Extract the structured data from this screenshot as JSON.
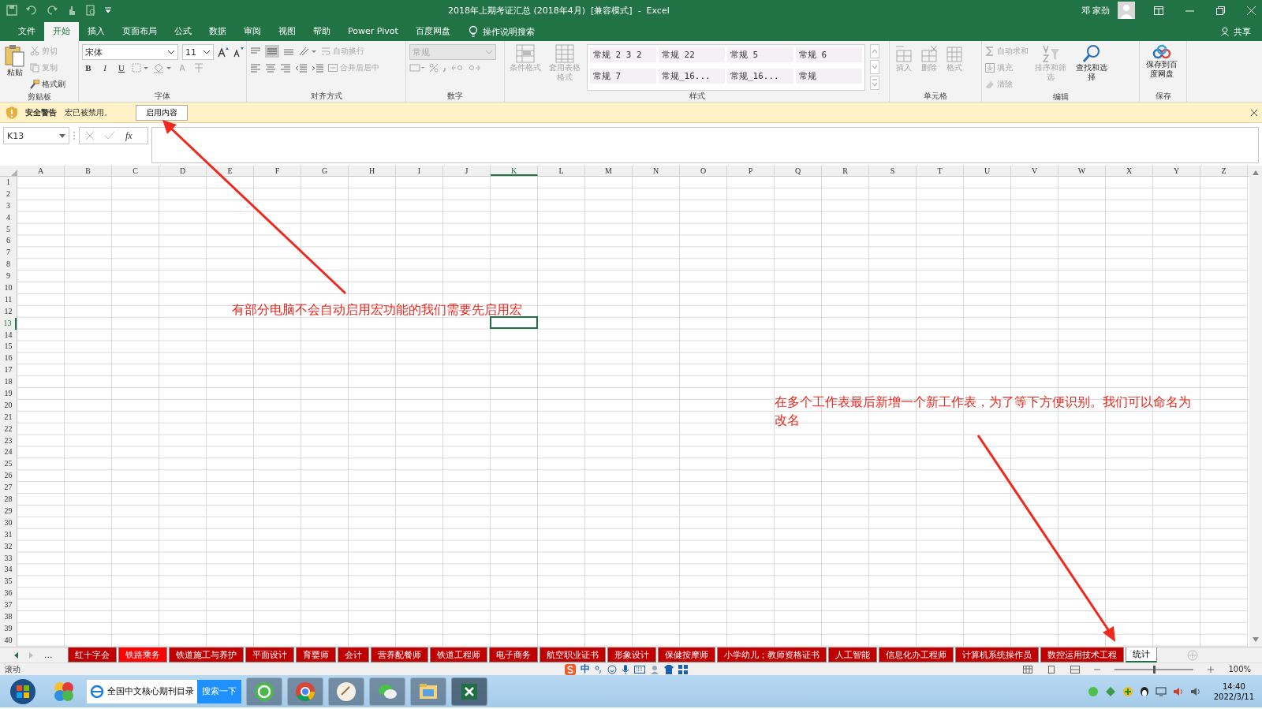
{
  "window": {
    "title": "2018年上期考证汇总 (2018年4月)  [兼容模式]  -  Excel",
    "user": "邓 家劲"
  },
  "ribbon_tabs": [
    {
      "label": "文件",
      "selected": false
    },
    {
      "label": "开始",
      "selected": true
    },
    {
      "label": "插入",
      "selected": false
    },
    {
      "label": "页面布局",
      "selected": false
    },
    {
      "label": "公式",
      "selected": false
    },
    {
      "label": "数据",
      "selected": false
    },
    {
      "label": "审阅",
      "selected": false
    },
    {
      "label": "视图",
      "selected": false
    },
    {
      "label": "帮助",
      "selected": false
    },
    {
      "label": "Power Pivot",
      "selected": false
    },
    {
      "label": "百度网盘",
      "selected": false
    }
  ],
  "tell_me": "操作说明搜索",
  "share": "共享",
  "ribbon": {
    "clipboard": {
      "label": "剪贴板",
      "paste": {
        "text": "粘贴",
        "disabled": false
      },
      "cut": {
        "text": "剪切",
        "disabled": true
      },
      "copy": {
        "text": "复制",
        "disabled": true
      },
      "painter": {
        "text": "格式刷",
        "disabled": false
      }
    },
    "font": {
      "label": "字体",
      "font_name": "宋体",
      "font_size": "11",
      "bold": "B",
      "italic": "I",
      "underline": "U",
      "color_letter": "A"
    },
    "alignment": {
      "label": "对齐方式",
      "wrap": {
        "text": "自动换行",
        "disabled": true
      },
      "merge": {
        "text": "合并后居中",
        "disabled": true
      }
    },
    "number": {
      "label": "数字",
      "format": {
        "text": "常规",
        "disabled": true
      }
    },
    "styles": {
      "label": "样式",
      "conditional": {
        "text": "条件格式",
        "disabled": true
      },
      "table_format": {
        "text": "套用表格格式",
        "disabled": true
      },
      "cell_styles": [
        "常规 2 3 2",
        "常规 22",
        "常规 5",
        "常规 6",
        "常规 7",
        "常规_16...",
        "常规_16...",
        "常规"
      ]
    },
    "cells": {
      "label": "单元格",
      "buttons": [
        {
          "text": "插入",
          "disabled": true
        },
        {
          "text": "删除",
          "disabled": true
        },
        {
          "text": "格式",
          "disabled": true
        }
      ]
    },
    "editing": {
      "label": "编辑",
      "autosum": {
        "text": "自动求和",
        "disabled": true
      },
      "fill": {
        "text": "填充",
        "disabled": true
      },
      "clear": {
        "text": "清除",
        "disabled": true
      },
      "sort": {
        "text": "排序和筛选",
        "disabled": true
      },
      "find": {
        "text": "查找和选择",
        "disabled": false
      }
    },
    "save": {
      "label": "保存",
      "button": "保存到百度网盘"
    }
  },
  "security_bar": {
    "title": "安全警告",
    "message": "宏已被禁用。",
    "button": "启用内容"
  },
  "formula_bar": {
    "name_box": "K13",
    "fx": "fx"
  },
  "columns": [
    {
      "label": "A",
      "selected": false
    },
    {
      "label": "B",
      "selected": false
    },
    {
      "label": "C",
      "selected": false
    },
    {
      "label": "D",
      "selected": false
    },
    {
      "label": "E",
      "selected": false
    },
    {
      "label": "F",
      "selected": false
    },
    {
      "label": "G",
      "selected": false
    },
    {
      "label": "H",
      "selected": false
    },
    {
      "label": "I",
      "selected": false
    },
    {
      "label": "J",
      "selected": false
    },
    {
      "label": "K",
      "selected": true
    },
    {
      "label": "L",
      "selected": false
    },
    {
      "label": "M",
      "selected": false
    },
    {
      "label": "N",
      "selected": false
    },
    {
      "label": "O",
      "selected": false
    },
    {
      "label": "P",
      "selected": false
    },
    {
      "label": "Q",
      "selected": false
    },
    {
      "label": "R",
      "selected": false
    },
    {
      "label": "S",
      "selected": false
    },
    {
      "label": "T",
      "selected": false
    },
    {
      "label": "U",
      "selected": false
    },
    {
      "label": "V",
      "selected": false
    },
    {
      "label": "W",
      "selected": false
    },
    {
      "label": "X",
      "selected": false
    },
    {
      "label": "Y",
      "selected": false
    },
    {
      "label": "Z",
      "selected": false
    }
  ],
  "rows": [
    {
      "label": "1",
      "selected": false
    },
    {
      "label": "2",
      "selected": false
    },
    {
      "label": "3",
      "selected": false
    },
    {
      "label": "4",
      "selected": false
    },
    {
      "label": "5",
      "selected": false
    },
    {
      "label": "6",
      "selected": false
    },
    {
      "label": "7",
      "selected": false
    },
    {
      "label": "8",
      "selected": false
    },
    {
      "label": "9",
      "selected": false
    },
    {
      "label": "10",
      "selected": false
    },
    {
      "label": "11",
      "selected": false
    },
    {
      "label": "12",
      "selected": false
    },
    {
      "label": "13",
      "selected": true
    },
    {
      "label": "14",
      "selected": false
    },
    {
      "label": "15",
      "selected": false
    },
    {
      "label": "16",
      "selected": false
    },
    {
      "label": "17",
      "selected": false
    },
    {
      "label": "18",
      "selected": false
    },
    {
      "label": "19",
      "selected": false
    },
    {
      "label": "20",
      "selected": false
    },
    {
      "label": "21",
      "selected": false
    },
    {
      "label": "22",
      "selected": false
    },
    {
      "label": "23",
      "selected": false
    },
    {
      "label": "24",
      "selected": false
    },
    {
      "label": "25",
      "selected": false
    },
    {
      "label": "26",
      "selected": false
    },
    {
      "label": "27",
      "selected": false
    },
    {
      "label": "28",
      "selected": false
    },
    {
      "label": "29",
      "selected": false
    },
    {
      "label": "30",
      "selected": false
    },
    {
      "label": "31",
      "selected": false
    },
    {
      "label": "32",
      "selected": false
    },
    {
      "label": "33",
      "selected": false
    },
    {
      "label": "34",
      "selected": false
    },
    {
      "label": "35",
      "selected": false
    },
    {
      "label": "36",
      "selected": false
    },
    {
      "label": "37",
      "selected": false
    },
    {
      "label": "38",
      "selected": false
    },
    {
      "label": "39",
      "selected": false
    },
    {
      "label": "40",
      "selected": false
    }
  ],
  "annotations": [
    {
      "text": "有部分电脑不会自动启用宏功能的我们需要先启用宏"
    },
    {
      "text": "在多个工作表最后新增一个新工作表，为了等下方便识别。我们可以命名为改名"
    }
  ],
  "sheet_nav": {
    "more": "..."
  },
  "sheet_tabs": [
    {
      "label": "红十字会",
      "selected": false,
      "color": "#c00000"
    },
    {
      "label": "铁路乘务",
      "selected": false,
      "color": "#ff0000"
    },
    {
      "label": "铁道施工与养护",
      "selected": false,
      "color": "#c00000"
    },
    {
      "label": "平面设计",
      "selected": false,
      "color": "#c00000"
    },
    {
      "label": "育婴师",
      "selected": false,
      "color": "#c00000"
    },
    {
      "label": "会计",
      "selected": false,
      "color": "#c00000"
    },
    {
      "label": "营养配餐师",
      "selected": false,
      "color": "#c00000"
    },
    {
      "label": "铁道工程师",
      "selected": false,
      "color": "#c00000"
    },
    {
      "label": "电子商务",
      "selected": false,
      "color": "#c00000"
    },
    {
      "label": "航空职业证书",
      "selected": false,
      "color": "#c00000"
    },
    {
      "label": "形象设计",
      "selected": false,
      "color": "#c00000"
    },
    {
      "label": "保健按摩师",
      "selected": false,
      "color": "#c00000"
    },
    {
      "label": "小学幼儿；教师资格证书",
      "selected": false,
      "color": "#c00000"
    },
    {
      "label": "人工智能",
      "selected": false,
      "color": "#c00000"
    },
    {
      "label": "信息化办工程师",
      "selected": false,
      "color": "#c00000"
    },
    {
      "label": "计算机系统操作员",
      "selected": false,
      "color": "#c00000"
    },
    {
      "label": "数控运用技术工程",
      "selected": false,
      "color": "#c00000"
    },
    {
      "label": "统计",
      "selected": true,
      "color": "#ffffff"
    }
  ],
  "status_bar": {
    "mode": "滚动",
    "ime": "中",
    "zoom": {
      "level": 0.5,
      "reading": "100%"
    }
  },
  "taskbar": {
    "search_text": "全国中文核心期刊目录",
    "search_button": "搜索一下",
    "time": "14:40",
    "date": "2022/3/11"
  }
}
